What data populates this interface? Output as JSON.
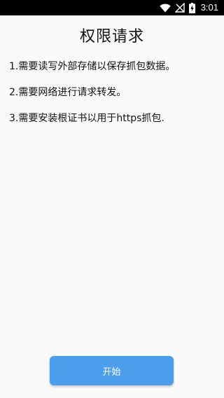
{
  "status_bar": {
    "time": "3:01",
    "icons": [
      "wifi-icon",
      "signal-off-icon",
      "battery-charging-icon"
    ]
  },
  "page": {
    "title": "权限请求",
    "permissions": [
      "1.需要读写外部存储以保存抓包数据。",
      "2.需要网络进行请求转发。",
      "3.需要安装根证书以用于https抓包."
    ],
    "start_button_label": "开始"
  },
  "colors": {
    "status_bar_bg": "#000000",
    "page_bg": "#fafafa",
    "text": "#111111",
    "accent": "#4a9eec",
    "button_text": "#ffffff"
  }
}
